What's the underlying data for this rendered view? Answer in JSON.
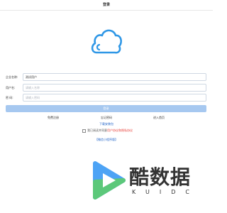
{
  "header": {
    "title": "登录"
  },
  "logo": {
    "icon": "cloud-icon",
    "color": "#2f97e6"
  },
  "form": {
    "company": {
      "label": "企业名称:",
      "value": "测试用户",
      "placeholder": ""
    },
    "username": {
      "label": "用户名:",
      "value": "",
      "placeholder": "请输入名称"
    },
    "password": {
      "label": "密 码:",
      "value": "",
      "placeholder": "请输入密码"
    }
  },
  "login_button": {
    "label": "登录",
    "color": "#a6c8f0"
  },
  "links": {
    "register": "免费注册",
    "forgot": "忘记密码",
    "home": "进入首页"
  },
  "download_link": "下载安装包",
  "agreement": {
    "text": "我已阅读并同意",
    "policy": "用户协议和隐私协议",
    "accent_color": "#e8403a"
  },
  "version_link": "【微信小程序版】",
  "watermark": {
    "name": "酷数据",
    "sub": "KUIDC",
    "colors": {
      "blue": "#4da3f5",
      "green": "#5cc87a",
      "dark": "#333333"
    }
  }
}
